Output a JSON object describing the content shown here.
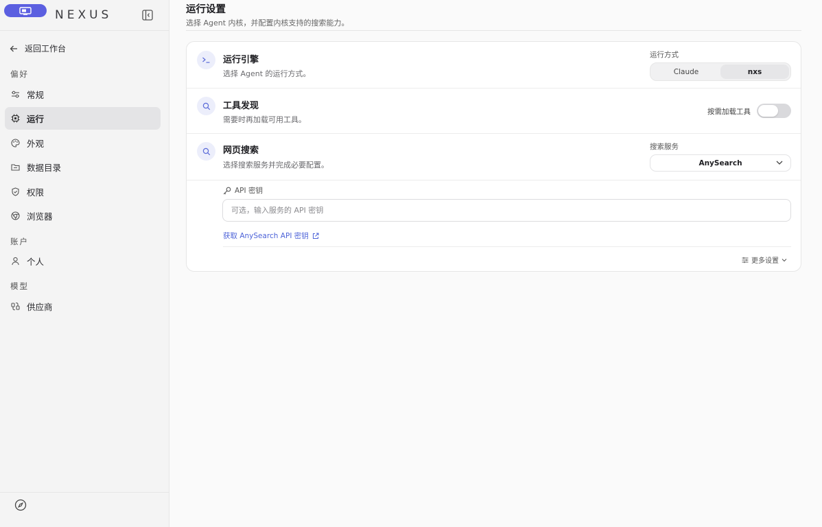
{
  "brand": {
    "name": "NEXUS",
    "accent": "#5b5fe0"
  },
  "sidebar": {
    "back_label": "返回工作台",
    "sections": {
      "preferences": "偏好",
      "account": "账户",
      "model": "模型"
    },
    "items": {
      "general": "常规",
      "run": "运行",
      "appearance": "外观",
      "data_dir": "数据目录",
      "permissions": "权限",
      "browser": "浏览器",
      "personal": "个人",
      "providers": "供应商"
    }
  },
  "page": {
    "title": "运行设置",
    "subtitle": "选择 Agent 内核，并配置内核支持的搜索能力。"
  },
  "engine": {
    "title": "运行引擎",
    "desc": "选择 Agent 的运行方式。",
    "field_label": "运行方式",
    "options": [
      "Claude",
      "nxs"
    ],
    "selected": "nxs"
  },
  "tools": {
    "title": "工具发现",
    "desc": "需要时再加载可用工具。",
    "toggle_label": "按需加载工具",
    "toggle_on": false
  },
  "web_search": {
    "title": "网页搜索",
    "desc": "选择搜索服务并完成必要配置。",
    "field_label": "搜索服务",
    "selected": "AnySearch",
    "api_label": "API 密钥",
    "api_value": "",
    "api_placeholder": "可选，输入服务的 API 密钥",
    "api_link": "获取 AnySearch API 密钥",
    "more_settings": "更多设置"
  }
}
